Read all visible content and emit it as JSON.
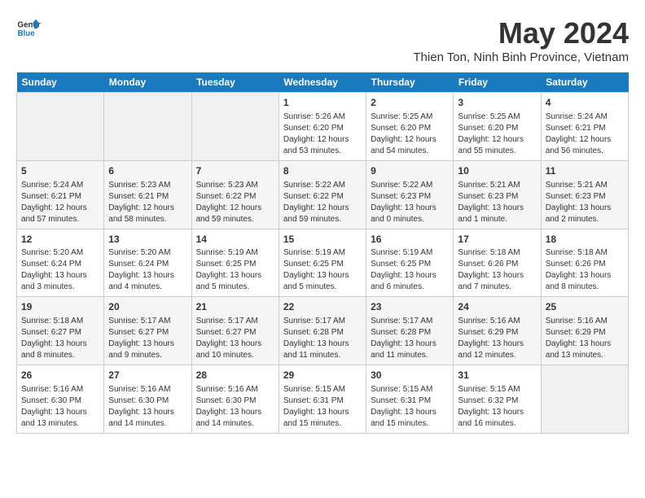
{
  "logo": {
    "line1": "General",
    "line2": "Blue"
  },
  "title": "May 2024",
  "location": "Thien Ton, Ninh Binh Province, Vietnam",
  "days_of_week": [
    "Sunday",
    "Monday",
    "Tuesday",
    "Wednesday",
    "Thursday",
    "Friday",
    "Saturday"
  ],
  "weeks": [
    [
      {
        "day": "",
        "info": ""
      },
      {
        "day": "",
        "info": ""
      },
      {
        "day": "",
        "info": ""
      },
      {
        "day": "1",
        "info": "Sunrise: 5:26 AM\nSunset: 6:20 PM\nDaylight: 12 hours\nand 53 minutes."
      },
      {
        "day": "2",
        "info": "Sunrise: 5:25 AM\nSunset: 6:20 PM\nDaylight: 12 hours\nand 54 minutes."
      },
      {
        "day": "3",
        "info": "Sunrise: 5:25 AM\nSunset: 6:20 PM\nDaylight: 12 hours\nand 55 minutes."
      },
      {
        "day": "4",
        "info": "Sunrise: 5:24 AM\nSunset: 6:21 PM\nDaylight: 12 hours\nand 56 minutes."
      }
    ],
    [
      {
        "day": "5",
        "info": "Sunrise: 5:24 AM\nSunset: 6:21 PM\nDaylight: 12 hours\nand 57 minutes."
      },
      {
        "day": "6",
        "info": "Sunrise: 5:23 AM\nSunset: 6:21 PM\nDaylight: 12 hours\nand 58 minutes."
      },
      {
        "day": "7",
        "info": "Sunrise: 5:23 AM\nSunset: 6:22 PM\nDaylight: 12 hours\nand 59 minutes."
      },
      {
        "day": "8",
        "info": "Sunrise: 5:22 AM\nSunset: 6:22 PM\nDaylight: 12 hours\nand 59 minutes."
      },
      {
        "day": "9",
        "info": "Sunrise: 5:22 AM\nSunset: 6:23 PM\nDaylight: 13 hours\nand 0 minutes."
      },
      {
        "day": "10",
        "info": "Sunrise: 5:21 AM\nSunset: 6:23 PM\nDaylight: 13 hours\nand 1 minute."
      },
      {
        "day": "11",
        "info": "Sunrise: 5:21 AM\nSunset: 6:23 PM\nDaylight: 13 hours\nand 2 minutes."
      }
    ],
    [
      {
        "day": "12",
        "info": "Sunrise: 5:20 AM\nSunset: 6:24 PM\nDaylight: 13 hours\nand 3 minutes."
      },
      {
        "day": "13",
        "info": "Sunrise: 5:20 AM\nSunset: 6:24 PM\nDaylight: 13 hours\nand 4 minutes."
      },
      {
        "day": "14",
        "info": "Sunrise: 5:19 AM\nSunset: 6:25 PM\nDaylight: 13 hours\nand 5 minutes."
      },
      {
        "day": "15",
        "info": "Sunrise: 5:19 AM\nSunset: 6:25 PM\nDaylight: 13 hours\nand 5 minutes."
      },
      {
        "day": "16",
        "info": "Sunrise: 5:19 AM\nSunset: 6:25 PM\nDaylight: 13 hours\nand 6 minutes."
      },
      {
        "day": "17",
        "info": "Sunrise: 5:18 AM\nSunset: 6:26 PM\nDaylight: 13 hours\nand 7 minutes."
      },
      {
        "day": "18",
        "info": "Sunrise: 5:18 AM\nSunset: 6:26 PM\nDaylight: 13 hours\nand 8 minutes."
      }
    ],
    [
      {
        "day": "19",
        "info": "Sunrise: 5:18 AM\nSunset: 6:27 PM\nDaylight: 13 hours\nand 8 minutes."
      },
      {
        "day": "20",
        "info": "Sunrise: 5:17 AM\nSunset: 6:27 PM\nDaylight: 13 hours\nand 9 minutes."
      },
      {
        "day": "21",
        "info": "Sunrise: 5:17 AM\nSunset: 6:27 PM\nDaylight: 13 hours\nand 10 minutes."
      },
      {
        "day": "22",
        "info": "Sunrise: 5:17 AM\nSunset: 6:28 PM\nDaylight: 13 hours\nand 11 minutes."
      },
      {
        "day": "23",
        "info": "Sunrise: 5:17 AM\nSunset: 6:28 PM\nDaylight: 13 hours\nand 11 minutes."
      },
      {
        "day": "24",
        "info": "Sunrise: 5:16 AM\nSunset: 6:29 PM\nDaylight: 13 hours\nand 12 minutes."
      },
      {
        "day": "25",
        "info": "Sunrise: 5:16 AM\nSunset: 6:29 PM\nDaylight: 13 hours\nand 13 minutes."
      }
    ],
    [
      {
        "day": "26",
        "info": "Sunrise: 5:16 AM\nSunset: 6:30 PM\nDaylight: 13 hours\nand 13 minutes."
      },
      {
        "day": "27",
        "info": "Sunrise: 5:16 AM\nSunset: 6:30 PM\nDaylight: 13 hours\nand 14 minutes."
      },
      {
        "day": "28",
        "info": "Sunrise: 5:16 AM\nSunset: 6:30 PM\nDaylight: 13 hours\nand 14 minutes."
      },
      {
        "day": "29",
        "info": "Sunrise: 5:15 AM\nSunset: 6:31 PM\nDaylight: 13 hours\nand 15 minutes."
      },
      {
        "day": "30",
        "info": "Sunrise: 5:15 AM\nSunset: 6:31 PM\nDaylight: 13 hours\nand 15 minutes."
      },
      {
        "day": "31",
        "info": "Sunrise: 5:15 AM\nSunset: 6:32 PM\nDaylight: 13 hours\nand 16 minutes."
      },
      {
        "day": "",
        "info": ""
      }
    ]
  ]
}
